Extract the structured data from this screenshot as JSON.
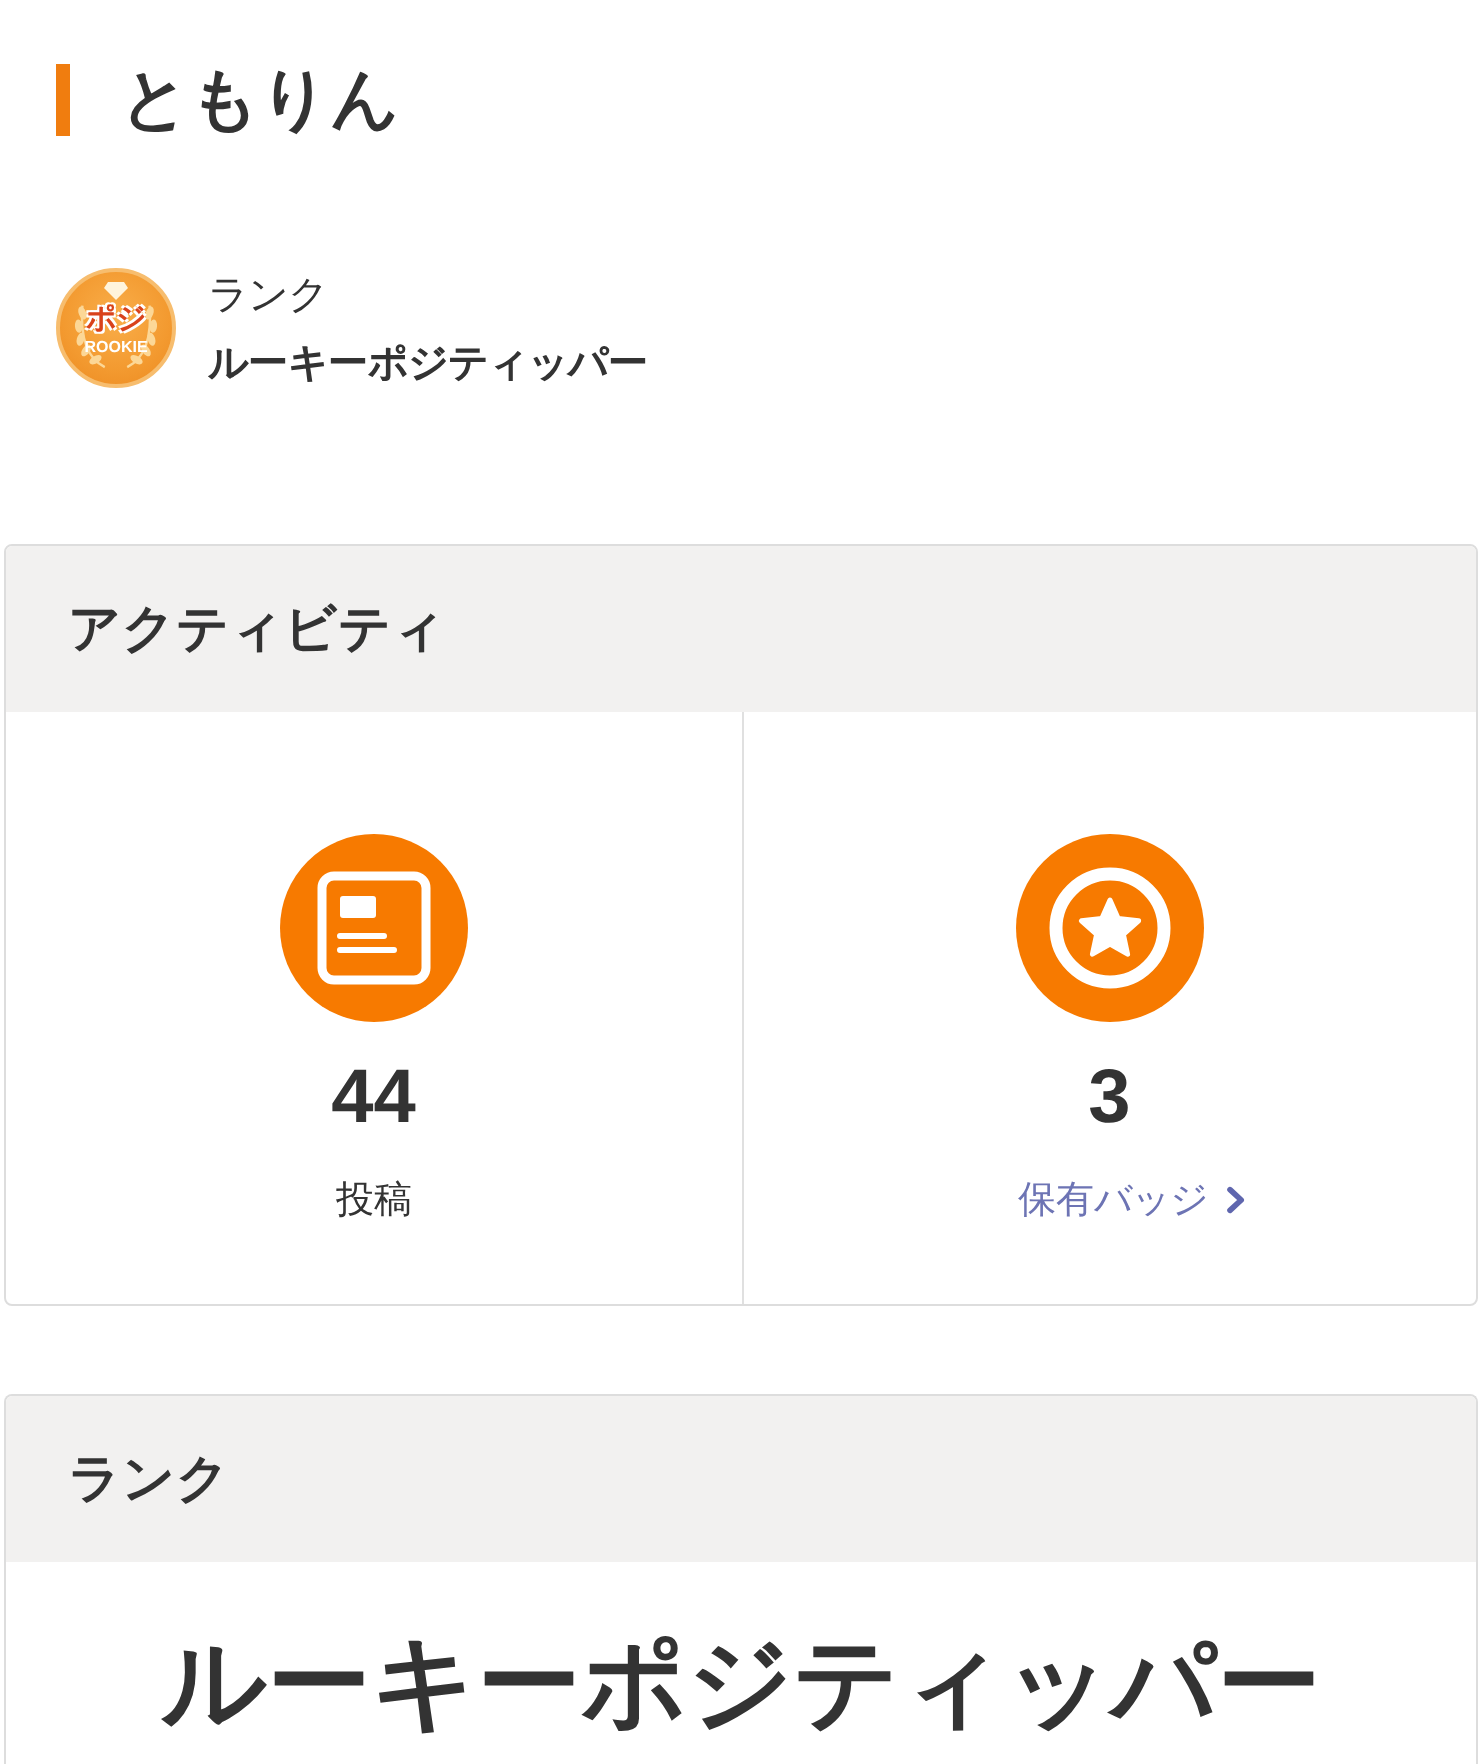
{
  "user": {
    "name": "ともりん"
  },
  "rank_summary": {
    "label": "ランク",
    "rank": "ルーキーポジティッパー",
    "badge": {
      "title": "ポジ",
      "caption": "ROOKIE"
    }
  },
  "activity": {
    "title": "アクティビティ",
    "stats": [
      {
        "kind": "posts",
        "value": "44",
        "label": "投稿",
        "link": false
      },
      {
        "kind": "badges",
        "value": "3",
        "label": "保有バッジ",
        "link": true
      }
    ]
  },
  "rank": {
    "title": "ランク",
    "name": "ルーキーポジティッパー"
  }
}
